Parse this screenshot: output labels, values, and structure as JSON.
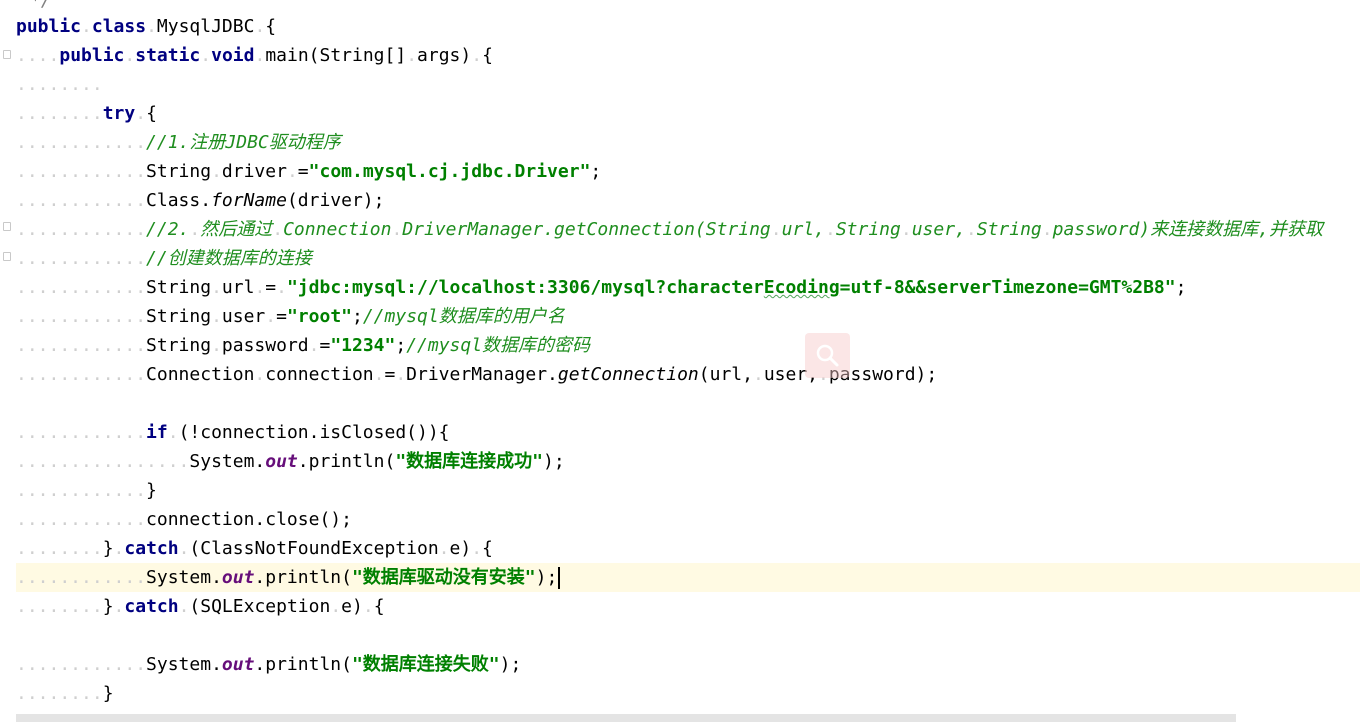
{
  "editor": {
    "top_fragment": "*/",
    "lines": [
      {
        "segments": [
          {
            "c": "kw",
            "t": "public"
          },
          {
            "c": "ws",
            "t": "."
          },
          {
            "c": "kw",
            "t": "class"
          },
          {
            "c": "ws",
            "t": "."
          },
          {
            "c": "",
            "t": "MysqlJDBC"
          },
          {
            "c": "ws",
            "t": "."
          },
          {
            "c": "",
            "t": "{"
          }
        ]
      },
      {
        "segments": [
          {
            "c": "ws",
            "t": "...."
          },
          {
            "c": "kw",
            "t": "public"
          },
          {
            "c": "ws",
            "t": "."
          },
          {
            "c": "kw",
            "t": "static"
          },
          {
            "c": "ws",
            "t": "."
          },
          {
            "c": "kw",
            "t": "void"
          },
          {
            "c": "ws",
            "t": "."
          },
          {
            "c": "",
            "t": "main(String[]"
          },
          {
            "c": "ws",
            "t": "."
          },
          {
            "c": "",
            "t": "args)"
          },
          {
            "c": "ws",
            "t": "."
          },
          {
            "c": "",
            "t": "{"
          }
        ]
      },
      {
        "segments": [
          {
            "c": "ws",
            "t": "........"
          }
        ]
      },
      {
        "segments": [
          {
            "c": "ws",
            "t": "........"
          },
          {
            "c": "kw",
            "t": "try"
          },
          {
            "c": "ws",
            "t": "."
          },
          {
            "c": "",
            "t": "{"
          }
        ]
      },
      {
        "segments": [
          {
            "c": "ws",
            "t": "............"
          },
          {
            "c": "cmt2",
            "t": "//1.注册JDBC驱动程序"
          }
        ]
      },
      {
        "segments": [
          {
            "c": "ws",
            "t": "............"
          },
          {
            "c": "",
            "t": "String"
          },
          {
            "c": "ws",
            "t": "."
          },
          {
            "c": "",
            "t": "driver"
          },
          {
            "c": "ws",
            "t": "."
          },
          {
            "c": "",
            "t": "="
          },
          {
            "c": "str",
            "t": "\"com.mysql.cj.jdbc.Driver\""
          },
          {
            "c": "",
            "t": ";"
          }
        ]
      },
      {
        "segments": [
          {
            "c": "ws",
            "t": "............"
          },
          {
            "c": "",
            "t": "Class."
          },
          {
            "c": "it",
            "t": "forName"
          },
          {
            "c": "",
            "t": "(driver);"
          }
        ]
      },
      {
        "segments": [
          {
            "c": "ws",
            "t": "............"
          },
          {
            "c": "cmt2",
            "t": "//2."
          },
          {
            "c": "ws",
            "t": "."
          },
          {
            "c": "cmt2",
            "t": "然后通过"
          },
          {
            "c": "ws",
            "t": "."
          },
          {
            "c": "cmt2",
            "t": "Connection"
          },
          {
            "c": "ws",
            "t": "."
          },
          {
            "c": "cmt2",
            "t": "DriverManager.getConnection(String"
          },
          {
            "c": "ws",
            "t": "."
          },
          {
            "c": "cmt2",
            "t": "url,"
          },
          {
            "c": "ws",
            "t": "."
          },
          {
            "c": "cmt2",
            "t": "String"
          },
          {
            "c": "ws",
            "t": "."
          },
          {
            "c": "cmt2",
            "t": "user,"
          },
          {
            "c": "ws",
            "t": "."
          },
          {
            "c": "cmt2",
            "t": "String"
          },
          {
            "c": "ws",
            "t": "."
          },
          {
            "c": "cmt2",
            "t": "password)来连接数据库,并获取"
          }
        ]
      },
      {
        "segments": [
          {
            "c": "ws",
            "t": "............"
          },
          {
            "c": "cmt2",
            "t": "//创建数据库的连接"
          }
        ]
      },
      {
        "segments": [
          {
            "c": "ws",
            "t": "............"
          },
          {
            "c": "",
            "t": "String"
          },
          {
            "c": "ws",
            "t": "."
          },
          {
            "c": "",
            "t": "url"
          },
          {
            "c": "ws",
            "t": "."
          },
          {
            "c": "",
            "t": "="
          },
          {
            "c": "ws",
            "t": "."
          },
          {
            "c": "str",
            "t": "\"jdbc:mysql://localhost:3306/mysql?character"
          },
          {
            "c": "str underline",
            "t": "Ecoding"
          },
          {
            "c": "str",
            "t": "=utf-8&&serverTimezone=GMT%2B8\""
          },
          {
            "c": "",
            "t": ";"
          }
        ]
      },
      {
        "segments": [
          {
            "c": "ws",
            "t": "............"
          },
          {
            "c": "",
            "t": "String"
          },
          {
            "c": "ws",
            "t": "."
          },
          {
            "c": "",
            "t": "user"
          },
          {
            "c": "ws",
            "t": "."
          },
          {
            "c": "",
            "t": "="
          },
          {
            "c": "str",
            "t": "\"root\""
          },
          {
            "c": "",
            "t": ";"
          },
          {
            "c": "cmt2",
            "t": "//mysql数据库的用户名"
          }
        ]
      },
      {
        "segments": [
          {
            "c": "ws",
            "t": "............"
          },
          {
            "c": "",
            "t": "String"
          },
          {
            "c": "ws",
            "t": "."
          },
          {
            "c": "",
            "t": "password"
          },
          {
            "c": "ws",
            "t": "."
          },
          {
            "c": "",
            "t": "="
          },
          {
            "c": "str",
            "t": "\"1234\""
          },
          {
            "c": "",
            "t": ";"
          },
          {
            "c": "cmt2",
            "t": "//mysql数据库的密码"
          }
        ]
      },
      {
        "segments": [
          {
            "c": "ws",
            "t": "............"
          },
          {
            "c": "",
            "t": "Connection"
          },
          {
            "c": "ws",
            "t": "."
          },
          {
            "c": "",
            "t": "connection"
          },
          {
            "c": "ws",
            "t": "."
          },
          {
            "c": "",
            "t": "="
          },
          {
            "c": "ws",
            "t": "."
          },
          {
            "c": "",
            "t": "DriverManager."
          },
          {
            "c": "it",
            "t": "getConnection"
          },
          {
            "c": "",
            "t": "(url,"
          },
          {
            "c": "ws",
            "t": "."
          },
          {
            "c": "",
            "t": "user,"
          },
          {
            "c": "ws",
            "t": "."
          },
          {
            "c": "",
            "t": "password);"
          }
        ]
      },
      {
        "segments": []
      },
      {
        "segments": [
          {
            "c": "ws",
            "t": "............"
          },
          {
            "c": "kw",
            "t": "if"
          },
          {
            "c": "ws",
            "t": "."
          },
          {
            "c": "",
            "t": "(!connection.isClosed()){"
          }
        ]
      },
      {
        "segments": [
          {
            "c": "ws",
            "t": "................"
          },
          {
            "c": "",
            "t": "System."
          },
          {
            "c": "field",
            "t": "out"
          },
          {
            "c": "",
            "t": ".println("
          },
          {
            "c": "str",
            "t": "\"数据库连接成功\""
          },
          {
            "c": "",
            "t": ");"
          }
        ]
      },
      {
        "segments": [
          {
            "c": "ws",
            "t": "............"
          },
          {
            "c": "",
            "t": "}"
          }
        ]
      },
      {
        "segments": [
          {
            "c": "ws",
            "t": "............"
          },
          {
            "c": "",
            "t": "connection.close();"
          }
        ]
      },
      {
        "segments": [
          {
            "c": "ws",
            "t": "........"
          },
          {
            "c": "",
            "t": "}"
          },
          {
            "c": "ws",
            "t": "."
          },
          {
            "c": "kw",
            "t": "catch"
          },
          {
            "c": "ws",
            "t": "."
          },
          {
            "c": "",
            "t": "(ClassNotFoundException"
          },
          {
            "c": "ws",
            "t": "."
          },
          {
            "c": "",
            "t": "e)"
          },
          {
            "c": "ws",
            "t": "."
          },
          {
            "c": "",
            "t": "{"
          }
        ]
      },
      {
        "segments": [
          {
            "c": "ws",
            "t": "............"
          },
          {
            "c": "",
            "t": "System."
          },
          {
            "c": "field",
            "t": "out"
          },
          {
            "c": "",
            "t": ".println("
          },
          {
            "c": "str",
            "t": "\"数据库驱动没有安装\""
          },
          {
            "c": "",
            "t": ");"
          }
        ],
        "current": true
      },
      {
        "segments": [
          {
            "c": "ws",
            "t": "........"
          },
          {
            "c": "",
            "t": "}"
          },
          {
            "c": "ws",
            "t": "."
          },
          {
            "c": "kw",
            "t": "catch"
          },
          {
            "c": "ws",
            "t": "."
          },
          {
            "c": "",
            "t": "(SQLException"
          },
          {
            "c": "ws",
            "t": "."
          },
          {
            "c": "",
            "t": "e)"
          },
          {
            "c": "ws",
            "t": "."
          },
          {
            "c": "",
            "t": "{"
          }
        ]
      },
      {
        "segments": []
      },
      {
        "segments": [
          {
            "c": "ws",
            "t": "............"
          },
          {
            "c": "",
            "t": "System."
          },
          {
            "c": "field",
            "t": "out"
          },
          {
            "c": "",
            "t": ".println("
          },
          {
            "c": "str",
            "t": "\"数据库连接失败\""
          },
          {
            "c": "",
            "t": ");"
          }
        ]
      },
      {
        "segments": [
          {
            "c": "ws",
            "t": "........"
          },
          {
            "c": "",
            "t": "}"
          }
        ]
      }
    ]
  },
  "overlay": {
    "icon": "search-icon"
  },
  "colors": {
    "keyword": "#000080",
    "string": "#008000",
    "comment": "#1f8e1f",
    "field": "#660e7a",
    "current_line": "#fffae3"
  }
}
